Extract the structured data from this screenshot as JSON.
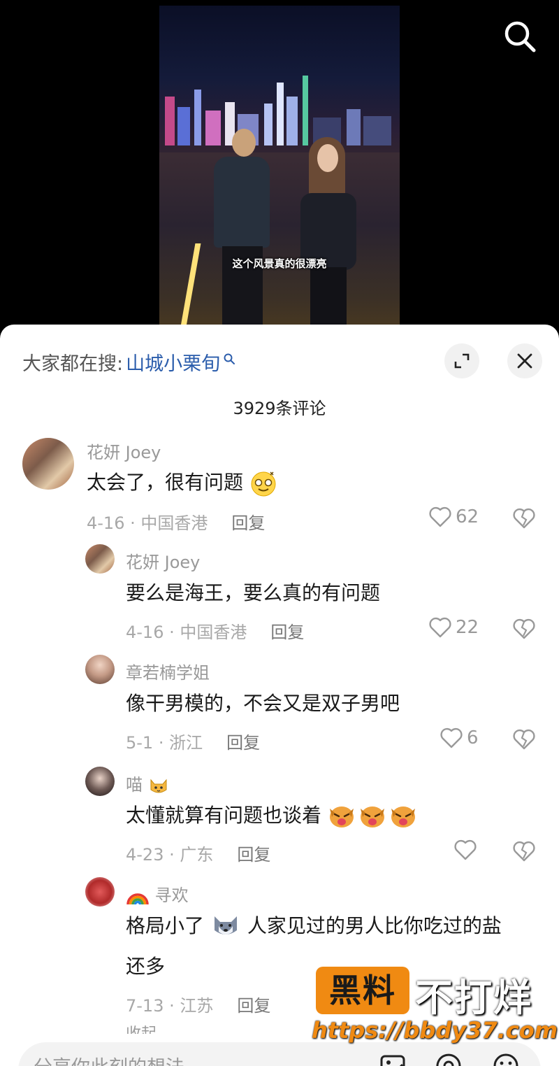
{
  "video": {
    "caption": "这个风景真的很漂亮"
  },
  "sheet": {
    "hot_search_prefix": "大家都在搜:",
    "hot_search_link": "山城小栗旬",
    "comment_count": "3929条评论"
  },
  "comments": [
    {
      "name": "花妍 Joey",
      "text": "太会了，很有问题",
      "date": "4-16 · 中国香港",
      "reply": "回复",
      "likes": "62"
    },
    {
      "name": "花妍 Joey",
      "text": "要么是海王，要么真的有问题",
      "date": "4-16 · 中国香港",
      "reply": "回复",
      "likes": "22"
    },
    {
      "name": "章若楠学姐",
      "text": "像干男模的，不会又是双子男吧",
      "date": "5-1 · 浙江",
      "reply": "回复",
      "likes": "6"
    },
    {
      "name": "喵",
      "text": "太懂就算有问题也谈着",
      "date": "4-23 · 广东",
      "reply": "回复",
      "likes": ""
    },
    {
      "name": "寻欢",
      "text_part1": "格局小了",
      "text_part2": "人家见过的男人比你吃过的盐",
      "text_line2": "还多",
      "date": "7-13 · 江苏",
      "reply": "回复"
    }
  ],
  "collapse_label": "收起",
  "input": {
    "placeholder": "分享你此刻的想法"
  },
  "watermark": {
    "box": "黑料",
    "text": "不打烊",
    "url": "https://bbdy37.com"
  },
  "colors": {
    "link": "#2a5cab",
    "watermark": "#f08a12"
  },
  "icons": [
    "search-icon",
    "expand-icon",
    "close-icon",
    "heart-icon",
    "broken-heart-icon",
    "image-icon",
    "at-icon",
    "emoji-icon"
  ]
}
